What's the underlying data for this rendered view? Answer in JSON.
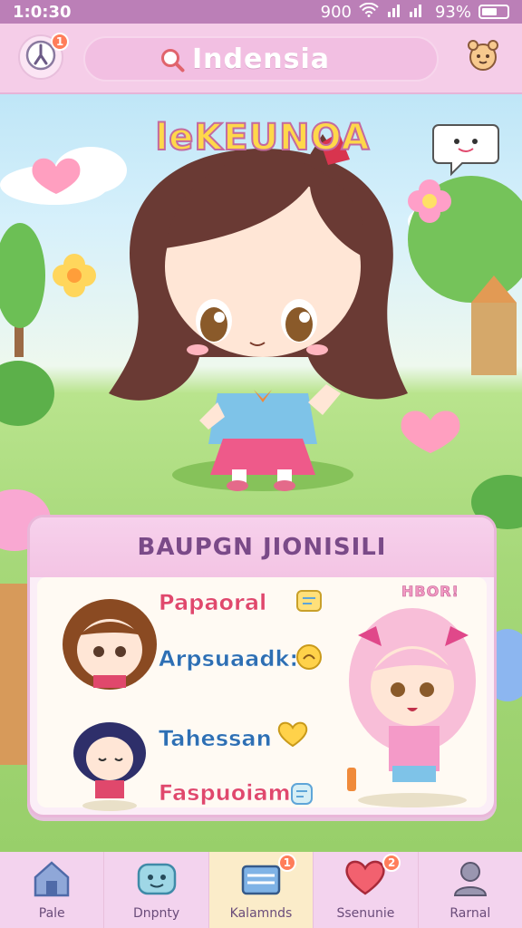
{
  "status_bar": {
    "time": "1:0:30",
    "right_text": "900",
    "battery_text": "93%"
  },
  "header": {
    "clock_badge": "1",
    "search": {
      "value": "Indensia"
    },
    "icons": {
      "left": "clock-icon",
      "search": "search-icon",
      "right": "pet-icon"
    }
  },
  "scene": {
    "title_logo": "leKEUNOA"
  },
  "panel": {
    "title": "BAUPGN JIONISILI",
    "side_label": "HBOR!",
    "stats": [
      {
        "label": "Papaoral",
        "icon": "note-icon"
      },
      {
        "label": "Arpsuaadk:",
        "icon": "coin-icon"
      },
      {
        "label": "Tahessan",
        "icon": "heart-icon"
      },
      {
        "label": "Faspuoiam!",
        "icon": "cup-icon"
      }
    ]
  },
  "bottom_nav": [
    {
      "label": "Pale",
      "icon": "home-icon",
      "badge": ""
    },
    {
      "label": "Dnpnty",
      "icon": "monster-icon",
      "badge": ""
    },
    {
      "label": "Kalamnds",
      "icon": "cards-icon",
      "badge": "1"
    },
    {
      "label": "Ssenunie",
      "icon": "heart-icon",
      "badge": "2"
    },
    {
      "label": "Rarnal",
      "icon": "profile-icon",
      "badge": ""
    }
  ],
  "colors": {
    "accent_pink": "#f3c4e4",
    "badge": "#ff7d5a",
    "label_red": "#e0486c",
    "label_blue": "#2e6fb3"
  }
}
